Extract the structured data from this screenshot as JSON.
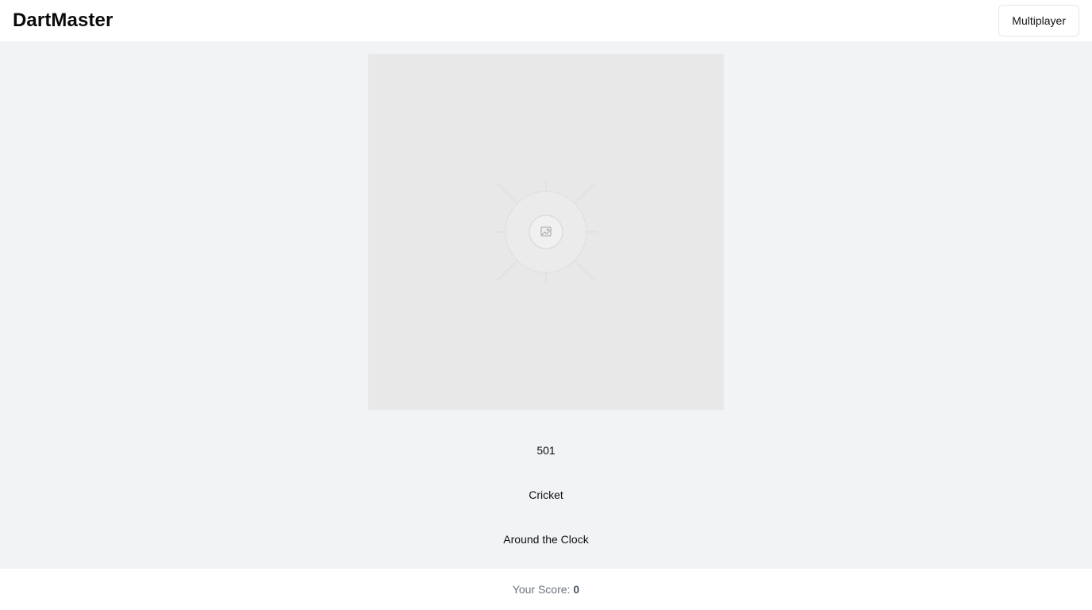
{
  "header": {
    "title": "DartMaster",
    "multiplayer_label": "Multiplayer"
  },
  "board": {
    "icon": "image-placeholder-icon"
  },
  "modes": [
    {
      "label": "501"
    },
    {
      "label": "Cricket"
    },
    {
      "label": "Around the Clock"
    }
  ],
  "footer": {
    "score_label": "Your Score:",
    "score_value": "0"
  }
}
